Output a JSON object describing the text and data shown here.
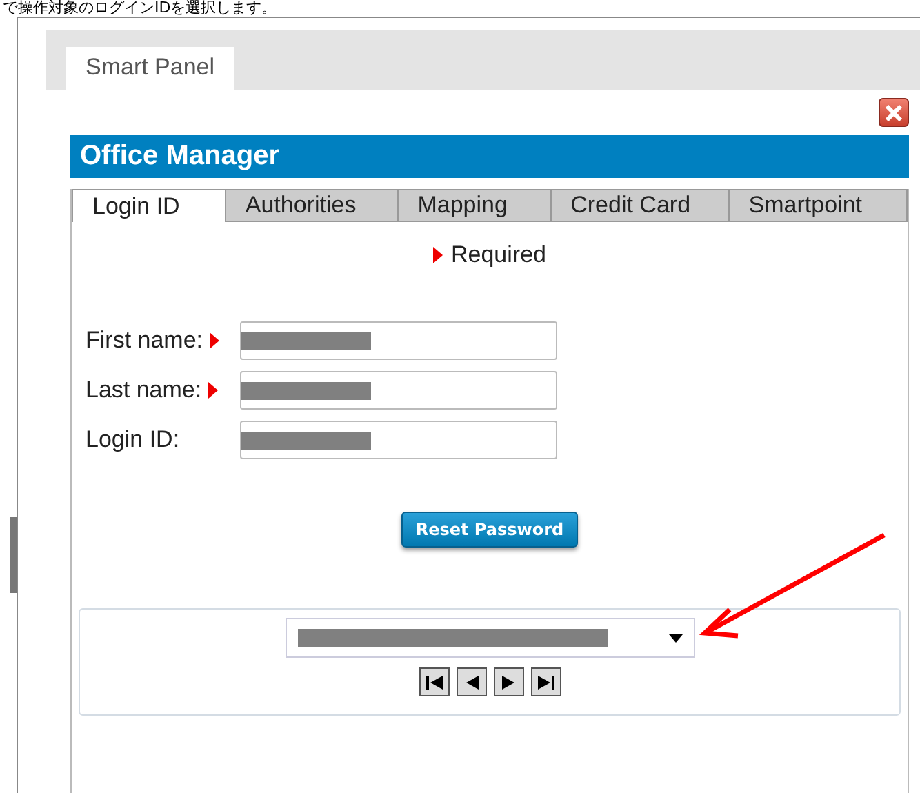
{
  "caption": "で操作対象のログインIDを選択します。",
  "panel_tab": {
    "label": "Smart Panel",
    "selected": true
  },
  "header": {
    "title": "Office Manager"
  },
  "tabs": [
    {
      "label": "Login ID",
      "selected": true
    },
    {
      "label": "Authorities",
      "selected": false
    },
    {
      "label": "Mapping",
      "selected": false
    },
    {
      "label": "Credit Card",
      "selected": false
    },
    {
      "label": "Smartpoint",
      "selected": false
    }
  ],
  "required_note": "Required",
  "fields": [
    {
      "label": "First name:",
      "required": true,
      "redacted": true
    },
    {
      "label": "Last name:",
      "required": true,
      "redacted": true
    },
    {
      "label": "Login ID:",
      "required": false,
      "redacted": true
    }
  ],
  "reset_button": "Reset Password",
  "login_select": {
    "redacted": true
  },
  "pager": [
    {
      "kind": "first"
    },
    {
      "kind": "prev"
    },
    {
      "kind": "next"
    },
    {
      "kind": "last"
    }
  ]
}
